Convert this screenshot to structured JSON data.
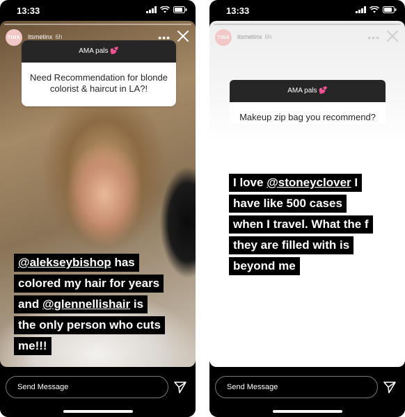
{
  "left": {
    "status": {
      "time": "13:33"
    },
    "story": {
      "username": "itsmetinx",
      "time_ago": "6h",
      "avatar_text": "TINX",
      "ama_title": "AMA pals 💕",
      "question": "Need Recommendation for blonde colorist & haircut in LA?!",
      "answer": {
        "line1_mention": "@alekseybishop",
        "line1_rest": " has",
        "line2": "colored my hair for years",
        "line3_pre": "and ",
        "line3_mention": "@glennellishair",
        "line3_rest": " is",
        "line4": "the only person who cuts",
        "line5": "me!!!"
      }
    },
    "composer": {
      "placeholder": "Send Message"
    }
  },
  "right": {
    "status": {
      "time": "13:33"
    },
    "story": {
      "username": "itsmetinx",
      "time_ago": "6h",
      "avatar_text": "TINX",
      "ama_title": "AMA pals 💕",
      "question": "Makeup zip bag you recommend?",
      "answer": {
        "line1_pre": "I love ",
        "line1_mention": "@stoneyclover",
        "line1_rest": " I",
        "line2": "have like 500 cases",
        "line3": "when I travel. What the f",
        "line4": "they are filled with is",
        "line5": "beyond me"
      }
    },
    "composer": {
      "placeholder": "Send Message"
    }
  },
  "icons": {
    "signal": "signal-icon",
    "wifi": "wifi-icon",
    "battery": "battery-icon",
    "more": "more-options-icon",
    "close": "close-icon",
    "send": "send-icon"
  }
}
